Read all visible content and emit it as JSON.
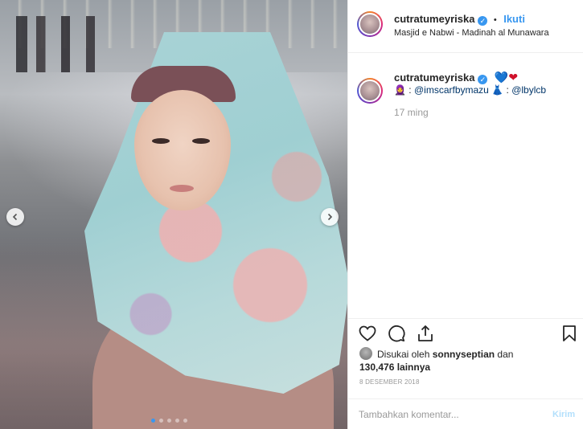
{
  "post": {
    "photo_carousel": {
      "slide_count": 5,
      "active_index": 0
    }
  },
  "header": {
    "username": "cutratumeyriska",
    "verified": true,
    "follow_label": "Ikuti",
    "separator": "•",
    "location": "Masjid e Nabwi - Madinah al Munawara"
  },
  "caption": {
    "username": "cutratumeyriska",
    "hearts": [
      "💙",
      "❤"
    ],
    "emoji_1": "🧕",
    "mention_1": "@imscarfbymazu",
    "emoji_2": "👗",
    "mention_2": "@lbylcb",
    "colon": ":",
    "time_ago": "17 ming"
  },
  "likes": {
    "prefix": "Disukai oleh",
    "liker": "sonnyseptian",
    "and": "dan",
    "count_text": "130,476 lainnya"
  },
  "date": "8 DESEMBER 2018",
  "comment_box": {
    "placeholder": "Tambahkan komentar...",
    "post_label": "Kirim"
  },
  "colors": {
    "accent_blue": "#3897f0",
    "post_disabled": "#b2dffc",
    "text": "#262626",
    "muted": "#999999"
  },
  "icons": [
    "chevron-left-icon",
    "chevron-right-icon",
    "heart-icon",
    "comment-icon",
    "share-icon",
    "bookmark-icon",
    "verified-badge-icon"
  ]
}
